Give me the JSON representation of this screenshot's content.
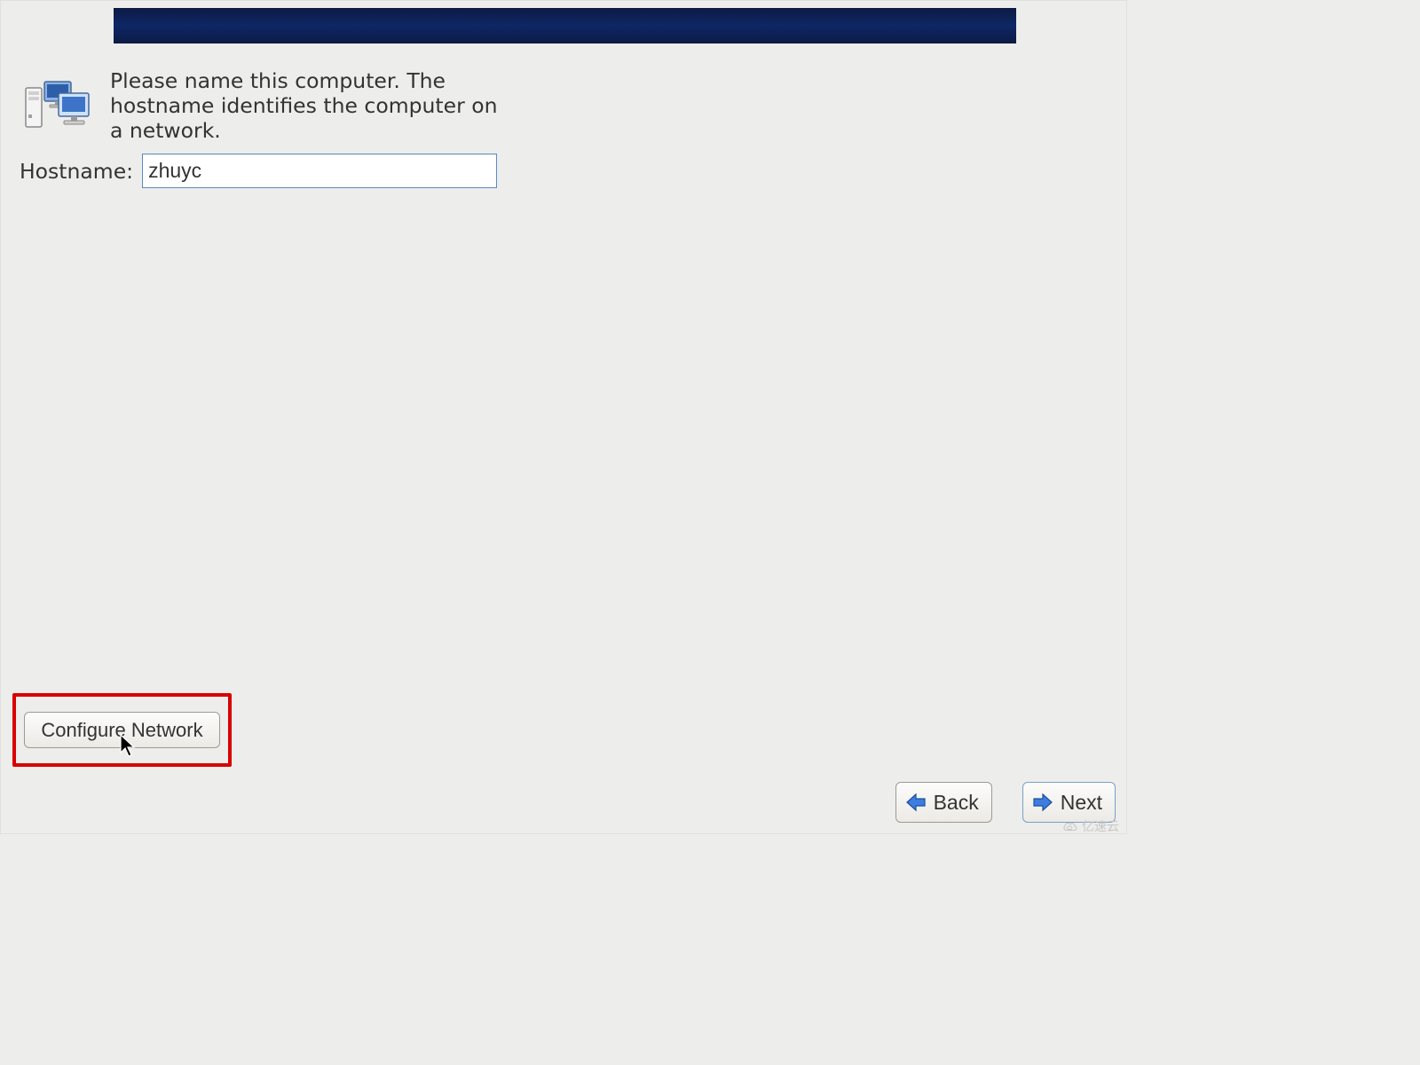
{
  "info_text": "Please name this computer.  The hostname identifies the computer on a network.",
  "hostname": {
    "label": "Hostname:",
    "value": "zhuyc"
  },
  "buttons": {
    "configure_network": "Configure Network",
    "back": "Back",
    "next": "Next"
  },
  "watermark_text": "亿速云"
}
